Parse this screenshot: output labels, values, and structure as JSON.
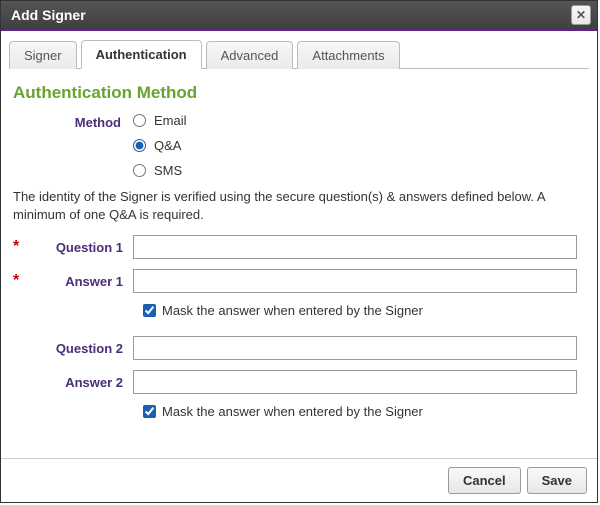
{
  "dialog": {
    "title": "Add Signer"
  },
  "tabs": {
    "signer": "Signer",
    "authentication": "Authentication",
    "advanced": "Advanced",
    "attachments": "Attachments"
  },
  "section": {
    "title": "Authentication Method",
    "method_label": "Method",
    "options": {
      "email": "Email",
      "qa": "Q&A",
      "sms": "SMS"
    },
    "selected": "qa",
    "description": "The identity of the Signer is verified using the secure question(s) & answers defined below. A minimum of one Q&A is required."
  },
  "fields": {
    "q1": {
      "label": "Question 1",
      "value": "",
      "required": true
    },
    "a1": {
      "label": "Answer 1",
      "value": "",
      "required": true
    },
    "mask1": {
      "label": "Mask the answer when entered by the Signer",
      "checked": true
    },
    "q2": {
      "label": "Question 2",
      "value": "",
      "required": false
    },
    "a2": {
      "label": "Answer 2",
      "value": "",
      "required": false
    },
    "mask2": {
      "label": "Mask the answer when entered by the Signer",
      "checked": true
    }
  },
  "footer": {
    "cancel": "Cancel",
    "save": "Save"
  }
}
